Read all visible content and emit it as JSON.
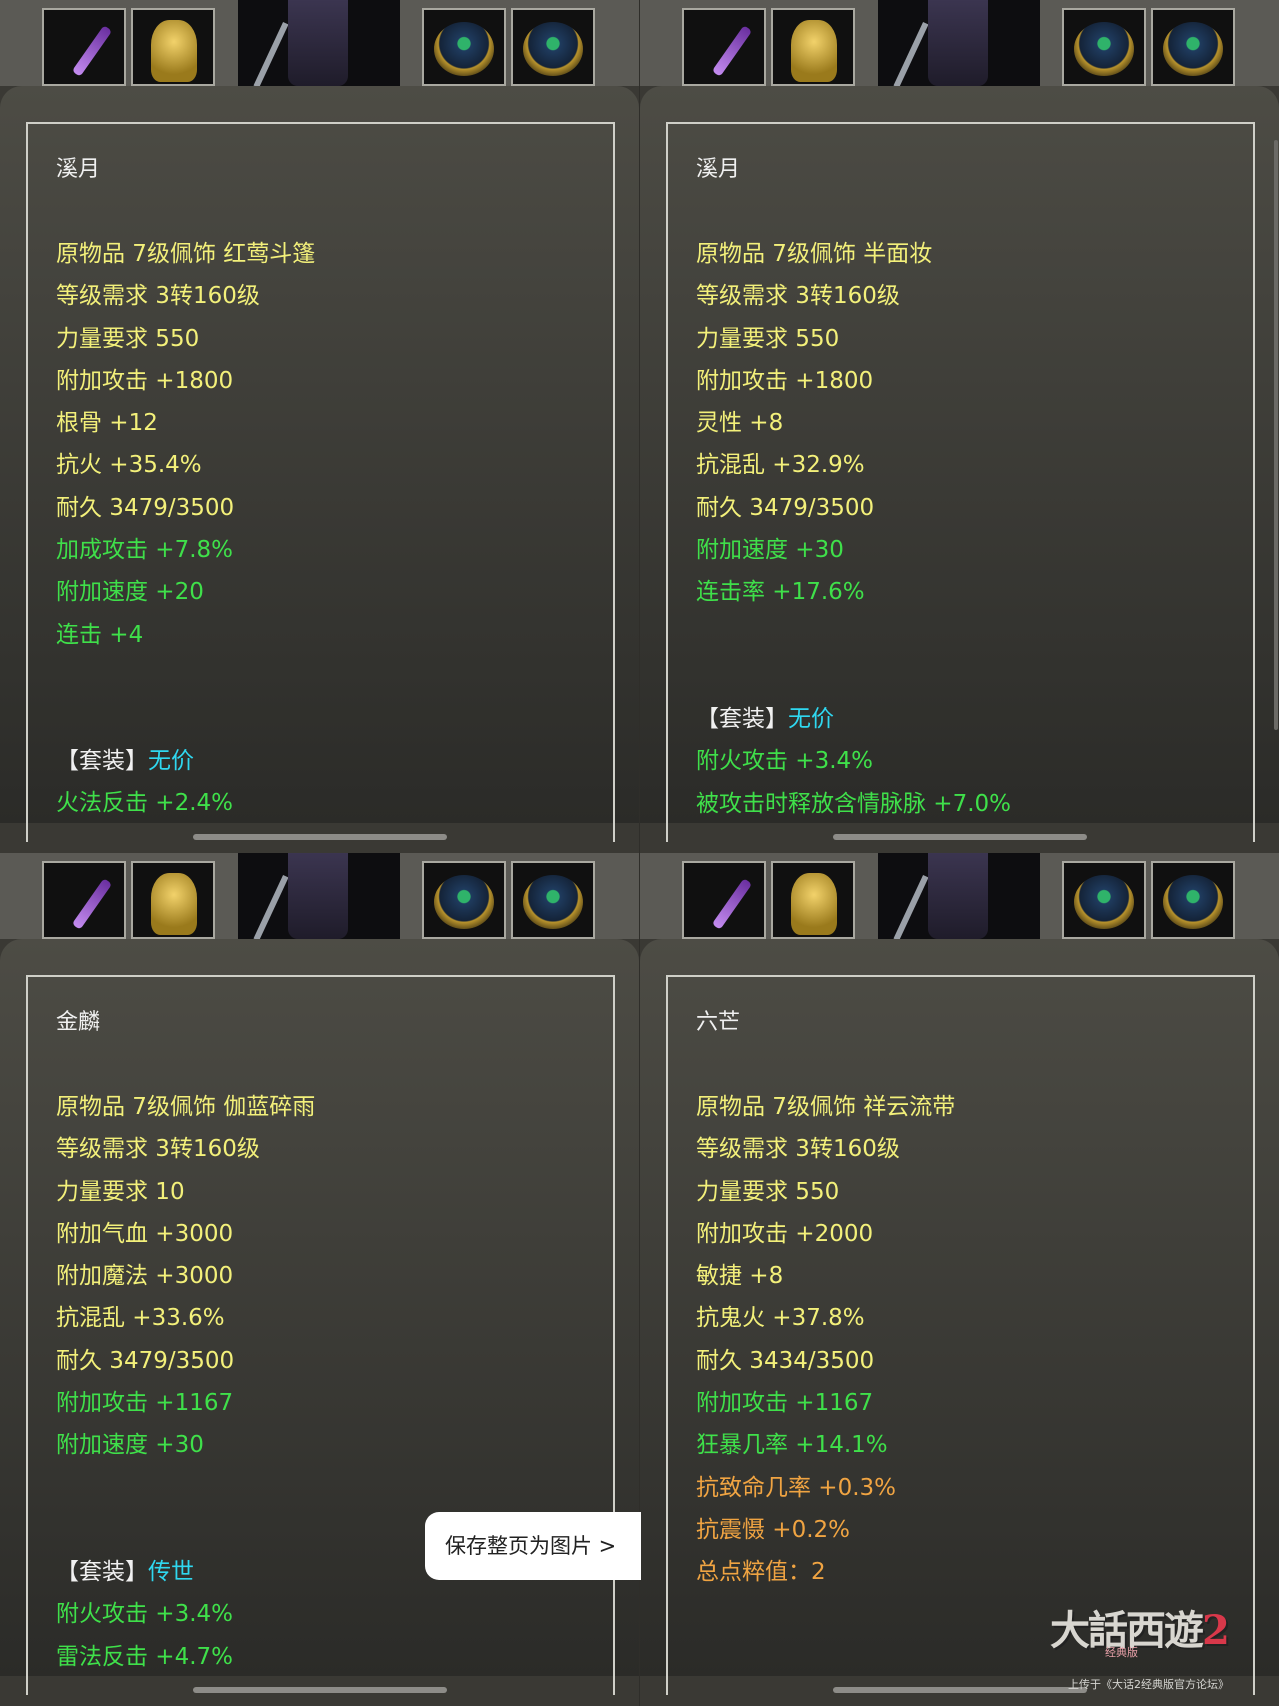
{
  "panels": [
    {
      "name": "溪月",
      "lines": [
        {
          "text": "原物品 7级佩饰 红莺斗篷",
          "color": "y"
        },
        {
          "text": "等级需求 3转160级",
          "color": "y"
        },
        {
          "text": "力量要求 550",
          "color": "y"
        },
        {
          "text": "附加攻击 +1800",
          "color": "y"
        },
        {
          "text": "根骨 +12",
          "color": "y"
        },
        {
          "text": "抗火 +35.4%",
          "color": "y"
        },
        {
          "text": "耐久 3479/3500",
          "color": "y"
        },
        {
          "text": "加成攻击 +7.8%",
          "color": "g"
        },
        {
          "text": "附加速度 +20",
          "color": "g"
        },
        {
          "text": "连击 +4",
          "color": "g"
        }
      ],
      "suit_bracket": "【套装】",
      "suit_name": "无价",
      "suit_lines": [
        "火法反击 +2.4%"
      ]
    },
    {
      "name": "溪月",
      "lines": [
        {
          "text": "原物品 7级佩饰 半面妆",
          "color": "y"
        },
        {
          "text": "等级需求 3转160级",
          "color": "y"
        },
        {
          "text": "力量要求 550",
          "color": "y"
        },
        {
          "text": "附加攻击 +1800",
          "color": "y"
        },
        {
          "text": "灵性 +8",
          "color": "y"
        },
        {
          "text": "抗混乱 +32.9%",
          "color": "y"
        },
        {
          "text": "耐久 3479/3500",
          "color": "y"
        },
        {
          "text": "附加速度 +30",
          "color": "g"
        },
        {
          "text": "连击率 +17.6%",
          "color": "g"
        }
      ],
      "suit_bracket": "【套装】",
      "suit_name": "无价",
      "suit_lines": [
        "附火攻击 +3.4%",
        "被攻击时释放含情脉脉 +7.0%"
      ]
    },
    {
      "name": "金麟",
      "lines": [
        {
          "text": "原物品 7级佩饰 伽蓝碎雨",
          "color": "y"
        },
        {
          "text": "等级需求 3转160级",
          "color": "y"
        },
        {
          "text": "力量要求 10",
          "color": "y"
        },
        {
          "text": "附加气血 +3000",
          "color": "y"
        },
        {
          "text": "附加魔法 +3000",
          "color": "y"
        },
        {
          "text": "抗混乱 +33.6%",
          "color": "y"
        },
        {
          "text": "耐久 3479/3500",
          "color": "y"
        },
        {
          "text": "附加攻击 +1167",
          "color": "g"
        },
        {
          "text": "附加速度 +30",
          "color": "g"
        }
      ],
      "suit_bracket": "【套装】",
      "suit_name": "传世",
      "suit_lines": [
        "附火攻击 +3.4%",
        "雷法反击 +4.7%"
      ]
    },
    {
      "name": "六芒",
      "lines": [
        {
          "text": "原物品 7级佩饰 祥云流带",
          "color": "y"
        },
        {
          "text": "等级需求 3转160级",
          "color": "y"
        },
        {
          "text": "力量要求 550",
          "color": "y"
        },
        {
          "text": "附加攻击 +2000",
          "color": "y"
        },
        {
          "text": "敏捷 +8",
          "color": "y"
        },
        {
          "text": "抗鬼火 +37.8%",
          "color": "y"
        },
        {
          "text": "耐久 3434/3500",
          "color": "y"
        },
        {
          "text": "附加攻击 +1167",
          "color": "g"
        },
        {
          "text": "狂暴几率 +14.1%",
          "color": "g"
        },
        {
          "text": "抗致命几率 +0.3%",
          "color": "o"
        },
        {
          "text": "抗震慑 +0.2%",
          "color": "o"
        },
        {
          "text": "总点粹值：2",
          "color": "o"
        }
      ]
    }
  ],
  "save_button": "保存整页为图片 >",
  "watermark": {
    "logo_main": "大話西遊",
    "logo_num": "2",
    "logo_sub": "经典版",
    "credit": "上传于《大话2经典版官方论坛》"
  }
}
